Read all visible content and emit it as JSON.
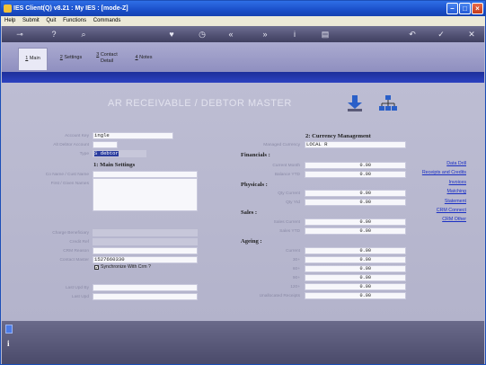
{
  "window": {
    "title": "IES Client(Q) v8.21 : My IES :      [mode-Z]"
  },
  "menu": [
    "Help",
    "Submit",
    "Quit",
    "Functions",
    "Commands"
  ],
  "toolbar_icons": [
    "key-icon",
    "help-icon",
    "search-icon",
    "heart-icon",
    "clock-icon",
    "rewind-icon",
    "fast-forward-icon",
    "info-icon",
    "print-icon",
    "back-icon",
    "check-icon",
    "close-icon"
  ],
  "tabs": [
    {
      "key": "1",
      "label": "Main"
    },
    {
      "key": "2",
      "label": "Settings"
    },
    {
      "key": "3",
      "label": "Contact Detail",
      "line1": "Contact",
      "line2": "Detail"
    },
    {
      "key": "4",
      "label": "Notes"
    }
  ],
  "page_title": "AR RECEIVABLE / DEBTOR MASTER",
  "left": {
    "account_key_label": "Account Key",
    "account_key": "ingle",
    "alt_debtor_label": "Alt Debtor Account",
    "alt_debtor": "",
    "type_label": "Type",
    "type": "S debtor",
    "section1": "1: Main Settings",
    "co_name_label": "Co Name / Cust Name",
    "first_given_label": "First / Given Names",
    "charge_beneficiary_label": "Charge Beneficiary",
    "credit_ref_label": "Credit Ref",
    "crm_reason_label": "CRM Reason",
    "contact_master_label": "Contact Master",
    "contact_master": "1527660330",
    "sync_label": "Synchronize With Crm ?",
    "sync_checked": true,
    "last_upd_by_label": "Last Upd By",
    "last_upd_label": "Last Upd"
  },
  "right": {
    "section2": "2: Currency Management",
    "managed_currency_label": "Managed Currency",
    "managed_currency": "LOCAL R",
    "financials": "Financials :",
    "current_month_label": "Current Month",
    "current_month": "0.00",
    "balance_ytd_label": "Balance YTD",
    "balance_ytd": "0.00",
    "physicals": "Physicals :",
    "qty_current_label": "Qty Current",
    "qty_current": "0.00",
    "qty_ytd_label": "Qty Ytd",
    "qty_ytd": "0.00",
    "sales": "Sales :",
    "sales_current_label": "Sales Current",
    "sales_current": "0.00",
    "sales_ytd_label": "Sales YTD",
    "sales_ytd": "0.00",
    "ageing": "Ageing :",
    "current_label": "Current",
    "current": "0.00",
    "d30_label": "30+",
    "d30": "0.00",
    "d60_label": "60+",
    "d60": "0.00",
    "d90_label": "90+",
    "d90": "0.00",
    "d120_label": "120+",
    "d120": "0.00",
    "unallocated_label": "Unallocated Receipts",
    "unallocated": "0.00"
  },
  "links": [
    "Data Drill",
    "Receipts and Credits",
    "Invoices",
    "Matching",
    "Statement",
    "CRM Connect",
    "CRM Other"
  ]
}
